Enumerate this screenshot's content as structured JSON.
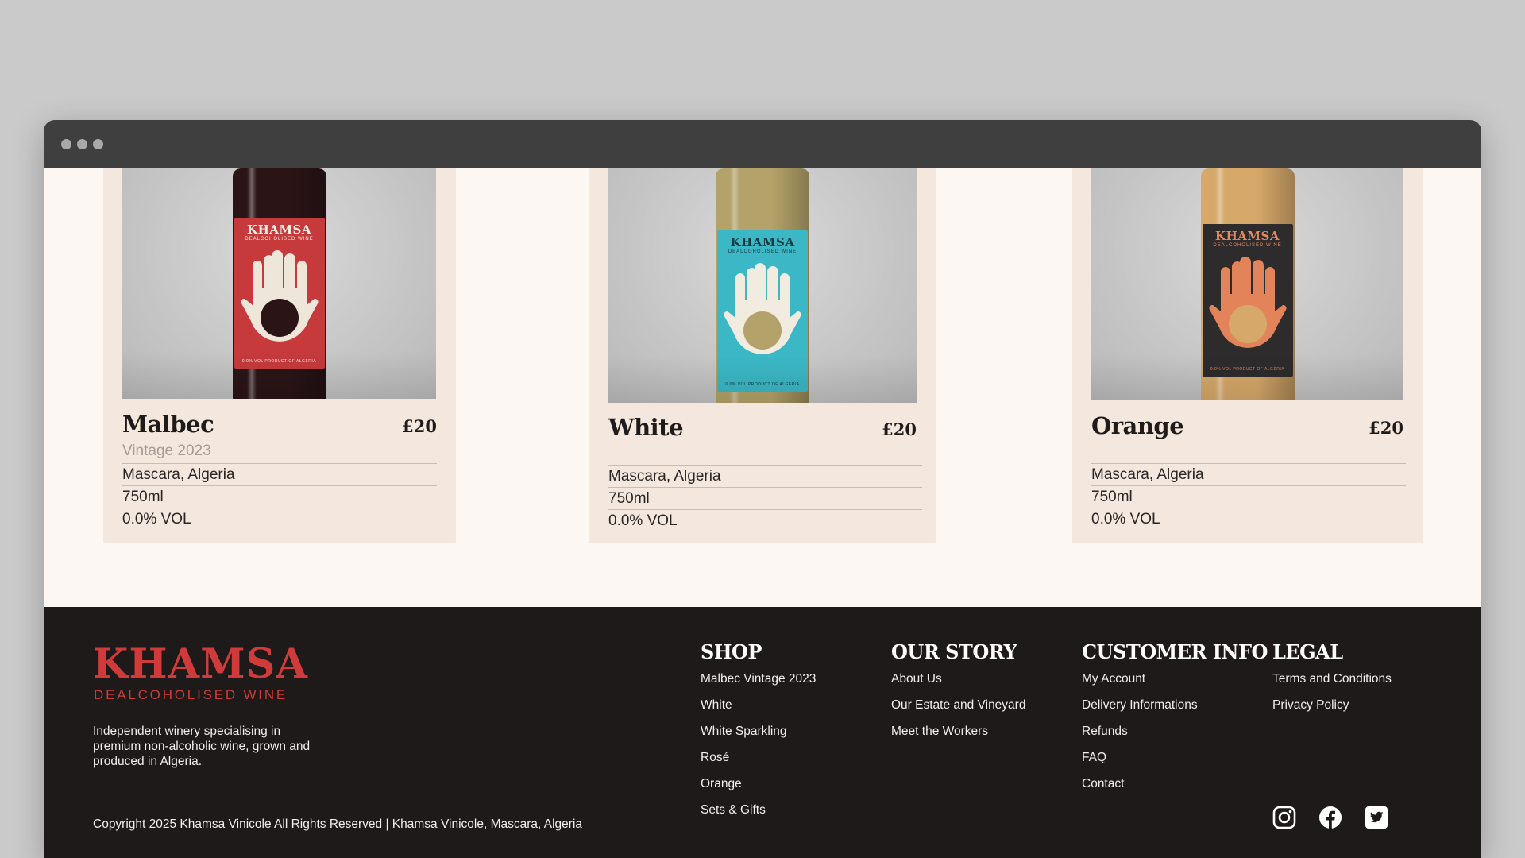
{
  "window": {
    "controls": [
      "close-dot",
      "minimize-dot",
      "maximize-dot"
    ]
  },
  "products": [
    {
      "name": "Malbec",
      "price": "£20",
      "vintage": "Vintage 2023",
      "specs": [
        "Mascara, Algeria",
        "750ml",
        "0.0% VOL"
      ],
      "label": {
        "brand": "KHAMSA",
        "sub": "DEALCOHOLISED WINE",
        "foot": "0.0% VOL   PRODUCT OF ALGERIA"
      },
      "colors": {
        "glass": "#2a1416",
        "label": "#c63a3c",
        "hand": "#efe6da",
        "text": "#f6ede4"
      }
    },
    {
      "name": "White",
      "price": "£20",
      "specs": [
        "Mascara, Algeria",
        "750ml",
        "0.0% VOL"
      ],
      "label": {
        "brand": "KHAMSA",
        "sub": "DEALCOHOLISED WINE",
        "foot": "0.0% VOL   PRODUCT OF ALGERIA"
      },
      "colors": {
        "glass": "#b3a269",
        "label": "#3bb7c5",
        "hand": "#f1ebe0",
        "text": "#17383d"
      }
    },
    {
      "name": "Orange",
      "price": "£20",
      "specs": [
        "Mascara, Algeria",
        "750ml",
        "0.0% VOL"
      ],
      "label": {
        "brand": "KHAMSA",
        "sub": "DEALCOHOLISED WINE",
        "foot": "0.0% VOL   PRODUCT OF ALGERIA"
      },
      "colors": {
        "glass": "#d6a86a",
        "label": "#2e2b2c",
        "hand": "#e2835a",
        "text": "#e58a5f"
      }
    }
  ],
  "footer": {
    "brand": "KHAMSA",
    "brand_sub": "DEALCOHOLISED WINE",
    "tagline": "Independent winery specialising in premium non-alcoholic wine, grown and produced in Algeria.",
    "copyright": "Copyright 2025 Khamsa Vinicole All Rights Reserved | Khamsa Vinicole, Mascara, Algeria",
    "columns": [
      {
        "title": "SHOP",
        "links": [
          "Malbec Vintage 2023",
          "White",
          "White Sparkling",
          "Rosé",
          "Orange",
          "Sets & Gifts"
        ]
      },
      {
        "title": "OUR STORY",
        "links": [
          "About Us",
          "Our Estate and Vineyard",
          "Meet the Workers"
        ]
      },
      {
        "title": "CUSTOMER INFO",
        "links": [
          "My Account",
          "Delivery Informations",
          "Refunds",
          "FAQ",
          "Contact"
        ]
      },
      {
        "title": "LEGAL",
        "links": [
          "Terms and Conditions",
          "Privacy Policy"
        ]
      }
    ],
    "social": [
      "instagram-icon",
      "facebook-icon",
      "twitter-icon"
    ]
  }
}
